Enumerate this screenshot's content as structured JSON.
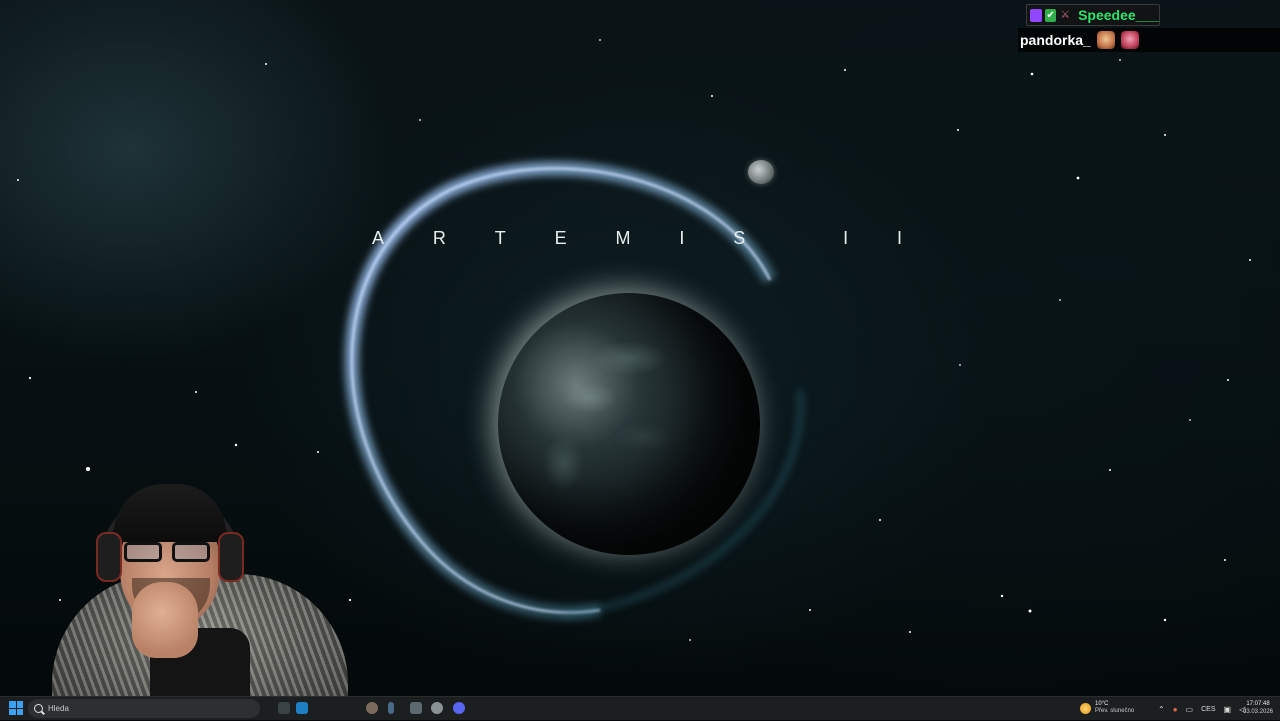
{
  "wallpaper": {
    "title_letters": [
      "A",
      "R",
      "T",
      "E",
      "M",
      "I",
      "S",
      "",
      "I",
      "I"
    ]
  },
  "chat": {
    "messages": [
      {
        "user": "Speedee___",
        "user_color": "#2fe36a",
        "badges": [
          "twitch-badge",
          "check-badge",
          "sword-badge"
        ]
      },
      {
        "user": "pandorka_",
        "user_color": "#ffffff",
        "emotes": [
          "emote-1",
          "emote-2"
        ]
      }
    ]
  },
  "taskbar": {
    "search_placeholder": "Hleda",
    "weather": {
      "temperature": "10°C",
      "description": "Přev. slunečno"
    },
    "tray": {
      "language": "CES"
    },
    "clock": {
      "time": "17:07:48",
      "date": "03.03.2026"
    }
  },
  "colors": {
    "accent": "#3ea0f0",
    "taskbar_bg": "#1c1f20"
  }
}
